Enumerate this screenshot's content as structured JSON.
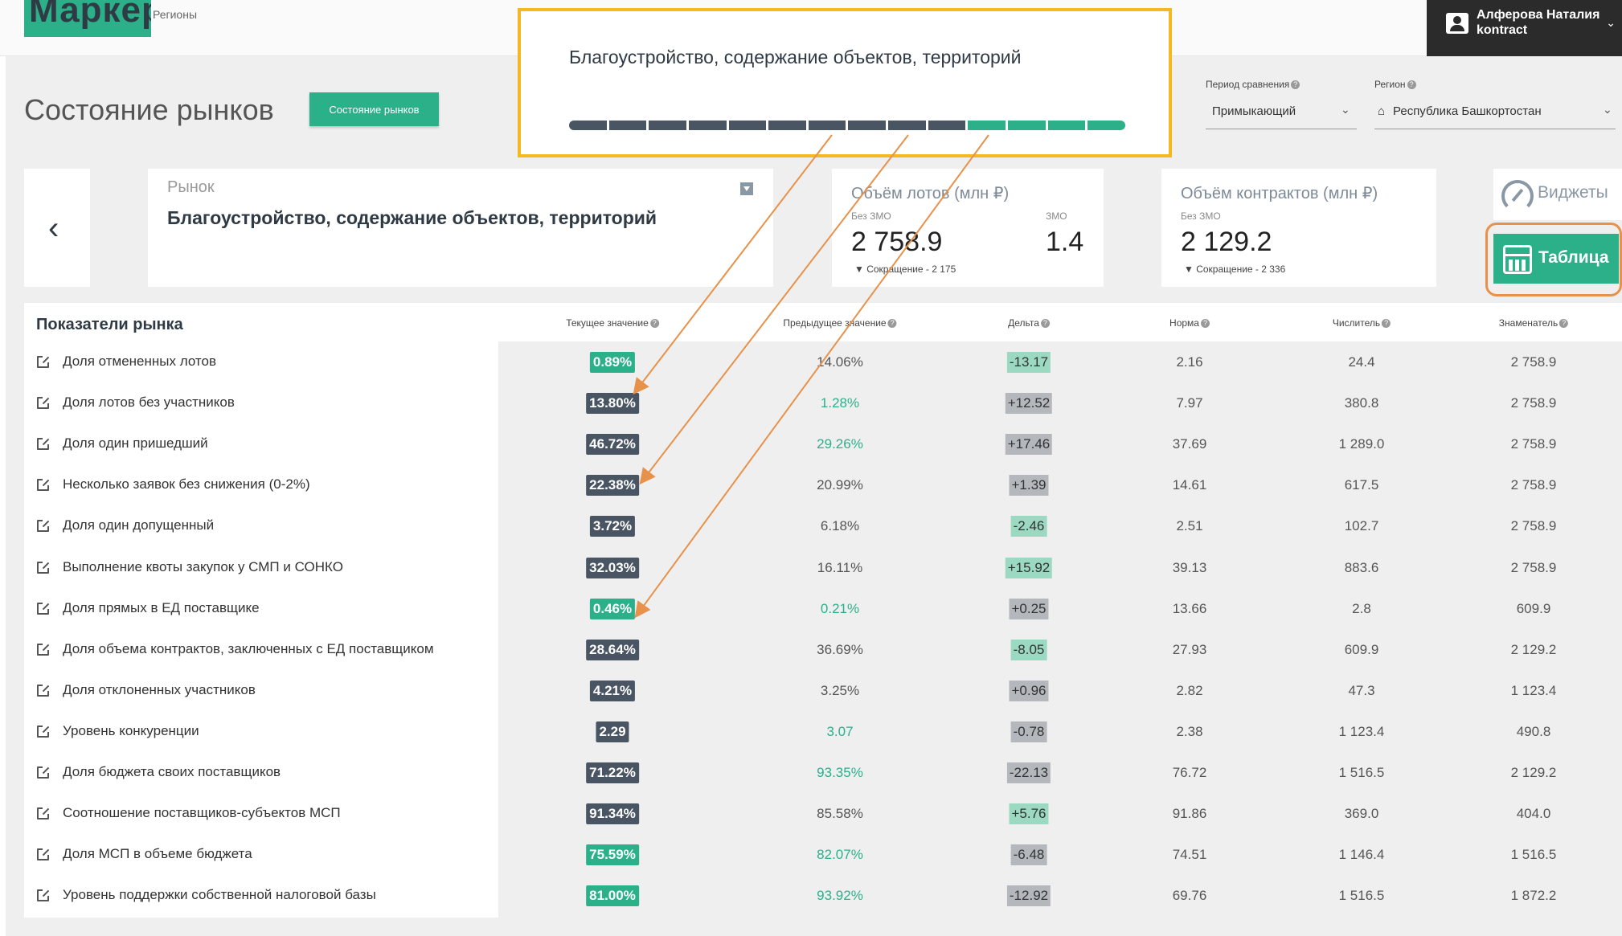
{
  "header": {
    "logo_text": "Маркер",
    "logo_sub": "Регионы",
    "user_name": "Алферова Наталия",
    "user_org": "kontract"
  },
  "page": {
    "title": "Состояние рынков",
    "title_button": "Состояние рынков"
  },
  "popup": {
    "title": "Благоустройство, содержание объектов, территорий",
    "segments_total": 14,
    "segments_green": 4
  },
  "filters": {
    "period_label": "Период сравнения",
    "period_value": "Примыкающий",
    "region_label": "Регион",
    "region_value": "Республика Башкортостан"
  },
  "market": {
    "label": "Рынок",
    "value": "Благоустройство, содержание объектов, территорий"
  },
  "volume": {
    "title": "Объём лотов (млн ₽)",
    "without_label": "Без ЗМО",
    "without_value": "2 758.9",
    "zmo_label": "ЗМО",
    "zmo_value": "1.4",
    "note": "Сокращение - 2 175"
  },
  "contracts": {
    "title": "Объём контрактов (млн ₽)",
    "without_label": "Без ЗМО",
    "without_value": "2 129.2",
    "note": "Сокращение - 2 336"
  },
  "side": {
    "widgets_label": "Виджеты",
    "table_label": "Таблица"
  },
  "table": {
    "section_title": "Показатели рынка",
    "columns": [
      "Текущее значение",
      "Предыдущее значение",
      "Дельта",
      "Норма",
      "Числитель",
      "Знаменатель"
    ],
    "rows": [
      {
        "label": "Доля отмененных лотов",
        "current": "0.89%",
        "current_style": "green",
        "previous": "14.06%",
        "previous_style": "gray",
        "delta": "-13.17",
        "delta_style": "green",
        "norm": "2.16",
        "num": "24.4",
        "den": "2 758.9"
      },
      {
        "label": "Доля лотов без участников",
        "current": "13.80%",
        "current_style": "dark",
        "previous": "1.28%",
        "previous_style": "green",
        "delta": "+12.52",
        "delta_style": "gray",
        "norm": "7.97",
        "num": "380.8",
        "den": "2 758.9"
      },
      {
        "label": "Доля один пришедший",
        "current": "46.72%",
        "current_style": "dark",
        "previous": "29.26%",
        "previous_style": "green",
        "delta": "+17.46",
        "delta_style": "gray",
        "norm": "37.69",
        "num": "1 289.0",
        "den": "2 758.9"
      },
      {
        "label": "Несколько заявок без снижения (0-2%)",
        "current": "22.38%",
        "current_style": "dark",
        "previous": "20.99%",
        "previous_style": "gray",
        "delta": "+1.39",
        "delta_style": "gray",
        "norm": "14.61",
        "num": "617.5",
        "den": "2 758.9"
      },
      {
        "label": "Доля один допущенный",
        "current": "3.72%",
        "current_style": "dark",
        "previous": "6.18%",
        "previous_style": "gray",
        "delta": "-2.46",
        "delta_style": "green",
        "norm": "2.51",
        "num": "102.7",
        "den": "2 758.9"
      },
      {
        "label": "Выполнение квоты закупок у СМП и СОНКО",
        "current": "32.03%",
        "current_style": "dark",
        "previous": "16.11%",
        "previous_style": "gray",
        "delta": "+15.92",
        "delta_style": "green",
        "norm": "39.13",
        "num": "883.6",
        "den": "2 758.9"
      },
      {
        "label": "Доля прямых в ЕД поставщике",
        "current": "0.46%",
        "current_style": "green",
        "previous": "0.21%",
        "previous_style": "green",
        "delta": "+0.25",
        "delta_style": "gray",
        "norm": "13.66",
        "num": "2.8",
        "den": "609.9"
      },
      {
        "label": "Доля объема контрактов, заключенных с ЕД поставщиком",
        "current": "28.64%",
        "current_style": "dark",
        "previous": "36.69%",
        "previous_style": "gray",
        "delta": "-8.05",
        "delta_style": "green",
        "norm": "27.93",
        "num": "609.9",
        "den": "2 129.2"
      },
      {
        "label": "Доля отклоненных участников",
        "current": "4.21%",
        "current_style": "dark",
        "previous": "3.25%",
        "previous_style": "gray",
        "delta": "+0.96",
        "delta_style": "gray",
        "norm": "2.82",
        "num": "47.3",
        "den": "1 123.4"
      },
      {
        "label": "Уровень конкуренции",
        "current": "2.29",
        "current_style": "dark",
        "previous": "3.07",
        "previous_style": "green",
        "delta": "-0.78",
        "delta_style": "gray",
        "norm": "2.38",
        "num": "1 123.4",
        "den": "490.8"
      },
      {
        "label": "Доля бюджета своих поставщиков",
        "current": "71.22%",
        "current_style": "dark",
        "previous": "93.35%",
        "previous_style": "green",
        "delta": "-22.13",
        "delta_style": "gray",
        "norm": "76.72",
        "num": "1 516.5",
        "den": "2 129.2"
      },
      {
        "label": "Соотношение поставщиков-субъектов МСП",
        "current": "91.34%",
        "current_style": "dark",
        "previous": "85.58%",
        "previous_style": "gray",
        "delta": "+5.76",
        "delta_style": "green",
        "norm": "91.86",
        "num": "369.0",
        "den": "404.0"
      },
      {
        "label": "Доля МСП в объеме бюджета",
        "current": "75.59%",
        "current_style": "green",
        "previous": "82.07%",
        "previous_style": "green",
        "delta": "-6.48",
        "delta_style": "gray",
        "norm": "74.51",
        "num": "1 146.4",
        "den": "1 516.5"
      },
      {
        "label": "Уровень поддержки собственной налоговой базы",
        "current": "81.00%",
        "current_style": "green",
        "previous": "93.92%",
        "previous_style": "green",
        "delta": "-12.92",
        "delta_style": "gray",
        "norm": "69.76",
        "num": "1 516.5",
        "den": "1 872.2"
      }
    ]
  },
  "colors": {
    "accent": "#2bb08a",
    "dark_badge": "#4a5563",
    "highlight": "#f5b820",
    "annotation": "#e8914a"
  }
}
